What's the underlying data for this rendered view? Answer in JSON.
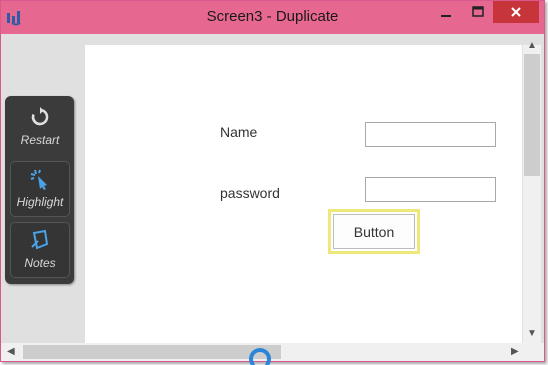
{
  "window": {
    "title": "Screen3 - Duplicate",
    "app_icon": "app-logo-icon",
    "controls": {
      "minimize_icon": "minimize-icon",
      "maximize_icon": "maximize-icon",
      "close_icon": "close-icon"
    }
  },
  "toolbar": {
    "items": [
      {
        "label": "Restart",
        "icon": "restart-icon"
      },
      {
        "label": "Highlight",
        "icon": "highlight-icon"
      },
      {
        "label": "Notes",
        "icon": "notes-icon"
      }
    ]
  },
  "form": {
    "name_label": "Name",
    "name_value": "",
    "password_label": "password",
    "password_value": "",
    "button_label": "Button"
  },
  "colors": {
    "titlebar": "#e6678f",
    "close_button": "#c7343a",
    "toolbar_bg": "#3b3b3b",
    "button_highlight": "#eee77a",
    "spinner": "#2b86d9"
  }
}
